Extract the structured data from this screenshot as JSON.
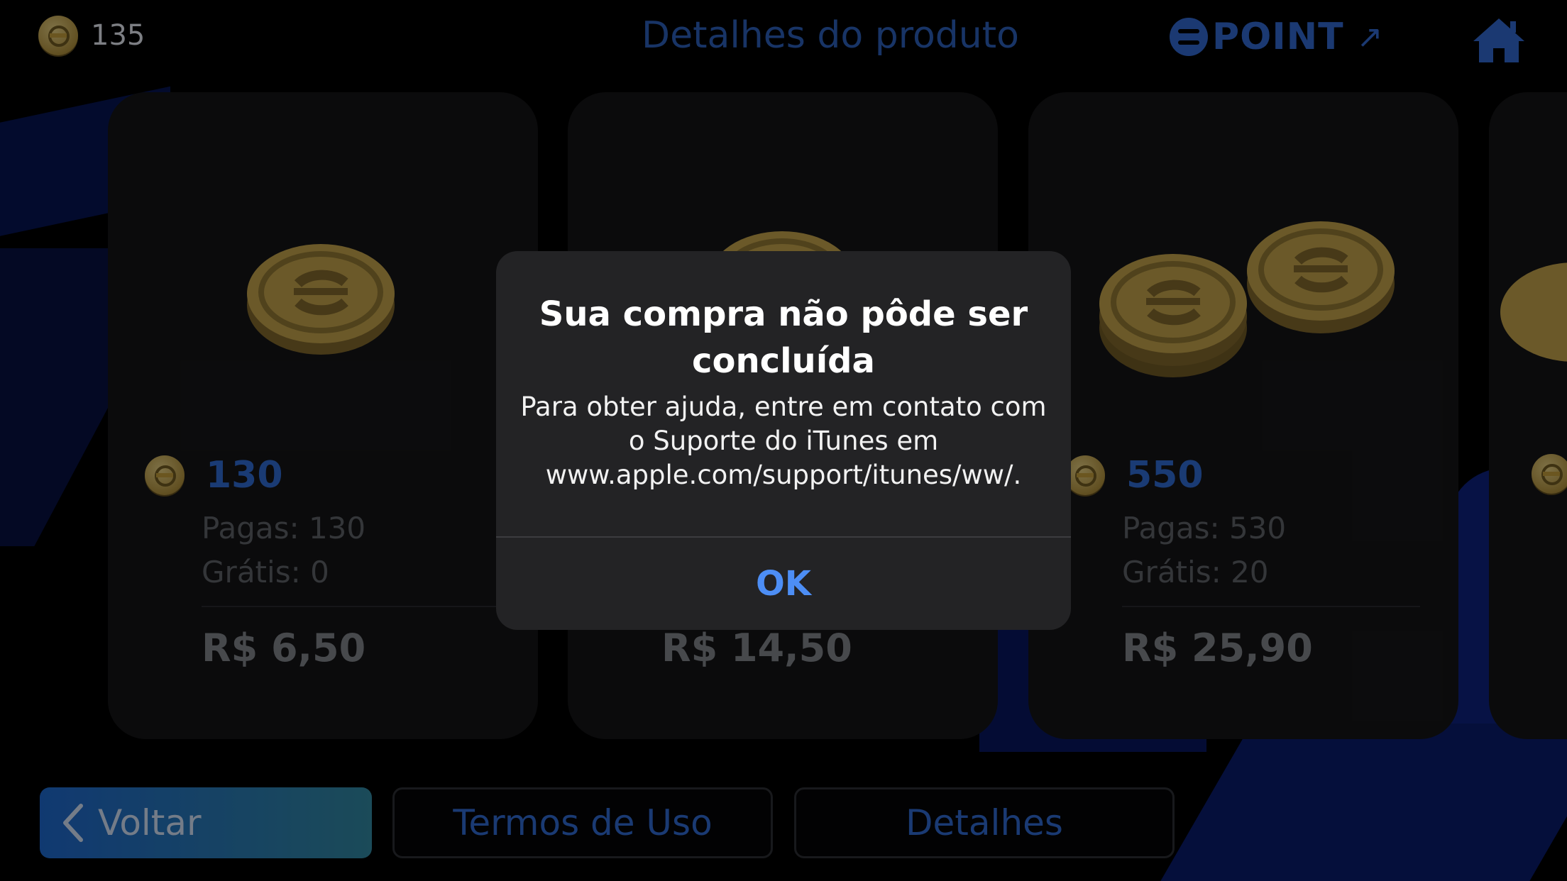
{
  "header": {
    "balance": "135",
    "title": "Detalhes do produto",
    "point_label": "POINT",
    "point_arrow": "↗"
  },
  "cards": [
    {
      "amount": "130",
      "paid": "Pagas: 130",
      "free": "Grátis: 0",
      "price": "R$ 6,50"
    },
    {
      "price": "R$ 14,50"
    },
    {
      "amount": "550",
      "paid": "Pagas: 530",
      "free": "Grátis: 20",
      "price": "R$ 25,90"
    }
  ],
  "footer": {
    "back_label": "Voltar",
    "terms_label": "Termos de Uso",
    "details_label": "Detalhes"
  },
  "dialog": {
    "title": "Sua compra não pôde ser concluída",
    "message": "Para obter ajuda, entre em contato com o Suporte do iTunes em www.apple.com/support/itunes/ww/.",
    "ok_label": "OK"
  },
  "colors": {
    "accent": "#2e66c8",
    "dialog_button": "#4d8ef5",
    "coin": "#b79a46"
  }
}
